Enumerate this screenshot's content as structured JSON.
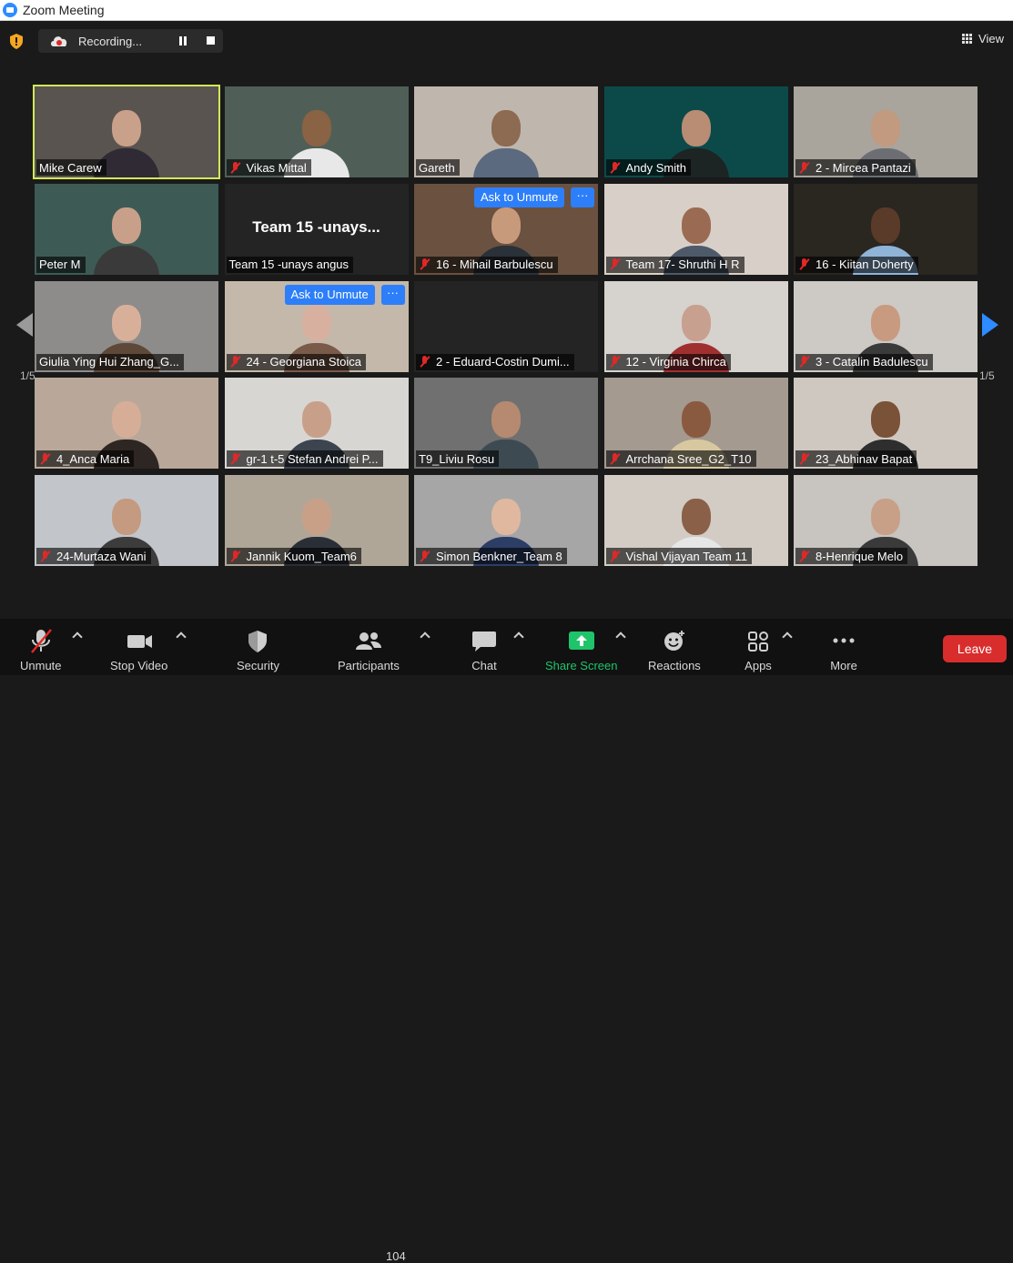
{
  "window": {
    "title": "Zoom Meeting"
  },
  "recording": {
    "label": "Recording..."
  },
  "view": {
    "label": "View"
  },
  "pagination": {
    "left_label": "1/5",
    "right_label": "1/5"
  },
  "ask_to_unmute": "Ask to Unmute",
  "more_dots": "···",
  "participants": [
    {
      "name": "Mike Carew",
      "muted": false,
      "active": true,
      "bg": "#5a5450",
      "skin": "#c9a08a",
      "shirt": "#2f2a33"
    },
    {
      "name": "Vikas Mittal",
      "muted": true,
      "bg": "#4f5f58",
      "skin": "#8a6244",
      "shirt": "#e8e8e8"
    },
    {
      "name": "Gareth",
      "muted": false,
      "bg": "#bfb6ad",
      "skin": "#8d6a52",
      "shirt": "#5b6a7e"
    },
    {
      "name": "Andy Smith",
      "muted": true,
      "bg": "#0c4a4a",
      "skin": "#b98c74",
      "shirt": "#1c2424"
    },
    {
      "name": "2 - Mircea Pantazi",
      "muted": true,
      "bg": "#a9a49c",
      "skin": "#c29a80",
      "shirt": "#6c6e74"
    },
    {
      "name": "Peter M",
      "muted": false,
      "bg": "#3e5a55",
      "skin": "#c8a08a",
      "shirt": "#3a3a3a"
    },
    {
      "name": "Team 15 -unays angus",
      "muted": false,
      "big_name": "Team 15 -unays...",
      "bg": "#242424",
      "no_video": true
    },
    {
      "name": "16 - Mihail Barbulescu",
      "muted": true,
      "bg": "#6a5140",
      "skin": "#c89a7c",
      "shirt": "#2a3138",
      "ask": true
    },
    {
      "name": "Team 17- Shruthi H R",
      "muted": true,
      "bg": "#d8d0c8",
      "skin": "#9a6b52",
      "shirt": "#4e5a6a"
    },
    {
      "name": "16 - Kiitan Doherty",
      "muted": true,
      "bg": "#2a2620",
      "skin": "#5a3a28",
      "shirt": "#8fb4d8"
    },
    {
      "name": "Giulia Ying Hui Zhang_G...",
      "muted": false,
      "bg": "#8e8c8a",
      "skin": "#d8b09a",
      "shirt": "#5e4838"
    },
    {
      "name": "24 - Georgiana Stoica",
      "muted": true,
      "bg": "#c4b8aa",
      "skin": "#d8b0a0",
      "shirt": "#7a5a48",
      "ask": true
    },
    {
      "name": "2 - Eduard-Costin Dumi...",
      "muted": true,
      "bg": "#242424",
      "no_video": true
    },
    {
      "name": "12 - Virginia Chirca",
      "muted": true,
      "bg": "#d6d2ce",
      "skin": "#c8a090",
      "shirt": "#a03030"
    },
    {
      "name": "3 - Catalin Badulescu",
      "muted": true,
      "bg": "#cdc9c5",
      "skin": "#c89a80",
      "shirt": "#3a3a3a"
    },
    {
      "name": "4_Anca Maria",
      "muted": true,
      "bg": "#b9a89a",
      "skin": "#d6ae98",
      "shirt": "#2e2622"
    },
    {
      "name": "gr-1 t-5 Stefan Andrei P...",
      "muted": true,
      "bg": "#d8d6d2",
      "skin": "#c8a08a",
      "shirt": "#3c4450"
    },
    {
      "name": "T9_Liviu Rosu",
      "muted": false,
      "bg": "#707070",
      "skin": "#b68a70",
      "shirt": "#3e4a52"
    },
    {
      "name": "Arrchana Sree_G2_T10",
      "muted": true,
      "bg": "#a49a90",
      "skin": "#8a5a40",
      "shirt": "#d8c8a0"
    },
    {
      "name": "23_Abhinav Bapat",
      "muted": true,
      "bg": "#cfc8c0",
      "skin": "#7a5238",
      "shirt": "#2e2e2e"
    },
    {
      "name": "24-Murtaza Wani",
      "muted": true,
      "bg": "#c2c6ca",
      "skin": "#c49a80",
      "shirt": "#3c3c3c"
    },
    {
      "name": "Jannik Kuom_Team6",
      "muted": true,
      "bg": "#b0a698",
      "skin": "#c8a088",
      "shirt": "#2a2e36"
    },
    {
      "name": "Simon Benkner_Team 8",
      "muted": true,
      "bg": "#a6a6a6",
      "skin": "#e0b8a0",
      "shirt": "#2c3e66"
    },
    {
      "name": "Vishal Vijayan Team 11",
      "muted": true,
      "bg": "#d2ccc4",
      "skin": "#8a6048",
      "shirt": "#e6e6e6"
    },
    {
      "name": "8-Henrique Melo",
      "muted": true,
      "bg": "#c8c4c0",
      "skin": "#c8a088",
      "shirt": "#3a3a3a"
    }
  ],
  "toolbar": {
    "unmute": "Unmute",
    "stop_video": "Stop Video",
    "security": "Security",
    "participants": "Participants",
    "participants_count": "104",
    "chat": "Chat",
    "share_screen": "Share Screen",
    "reactions": "Reactions",
    "apps": "Apps",
    "more": "More",
    "leave": "Leave"
  },
  "colors": {
    "accent": "#2d8cff",
    "share_green": "#1fc46a",
    "leave_red": "#d92d2d",
    "active_speaker": "#d2e85a",
    "muted_red": "#e02828"
  }
}
